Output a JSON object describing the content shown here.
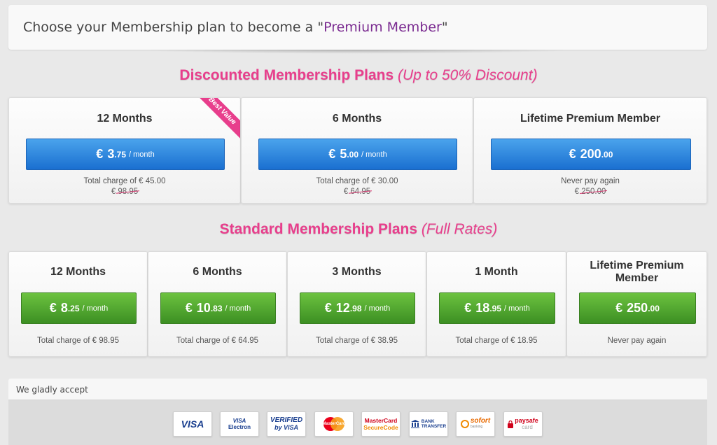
{
  "header": {
    "title_prefix": "Choose your Membership plan to become a ",
    "title_quote_open": "\"",
    "title_accent": "Premium Member",
    "title_quote_close": "\""
  },
  "discounted": {
    "title": "Discounted Membership Plans",
    "subtitle": "(Up to 50% Discount)",
    "plans": [
      {
        "name": "12 Months",
        "currency": "€",
        "amount": "3",
        "cents": ".75",
        "period": "/ month",
        "charge": "Total charge of € 45.00",
        "orig_prefix": "€ ",
        "orig_value": "98.95",
        "ribbon": "Best Value"
      },
      {
        "name": "6 Months",
        "currency": "€",
        "amount": "5",
        "cents": ".00",
        "period": "/ month",
        "charge": "Total charge of € 30.00",
        "orig_prefix": "€ ",
        "orig_value": "64.95"
      },
      {
        "name": "Lifetime Premium Member",
        "currency": "€",
        "amount": "200",
        "cents": ".00",
        "period": "",
        "charge": "Never pay again",
        "orig_prefix": "€ ",
        "orig_value": "250.00"
      }
    ]
  },
  "standard": {
    "title": "Standard Membership Plans",
    "subtitle": "(Full Rates)",
    "plans": [
      {
        "name": "12 Months",
        "currency": "€",
        "amount": "8",
        "cents": ".25",
        "period": "/ month",
        "charge": "Total charge of € 98.95"
      },
      {
        "name": "6 Months",
        "currency": "€",
        "amount": "10",
        "cents": ".83",
        "period": "/ month",
        "charge": "Total charge of € 64.95"
      },
      {
        "name": "3 Months",
        "currency": "€",
        "amount": "12",
        "cents": ".98",
        "period": "/ month",
        "charge": "Total charge of € 38.95"
      },
      {
        "name": "1 Month",
        "currency": "€",
        "amount": "18",
        "cents": ".95",
        "period": "/ month",
        "charge": "Total charge of € 18.95"
      },
      {
        "name": "Lifetime Premium Member",
        "currency": "€",
        "amount": "250",
        "cents": ".00",
        "period": "",
        "charge": "Never pay again"
      }
    ]
  },
  "payments": {
    "label": "We gladly accept",
    "logos": [
      {
        "name": "visa",
        "line1": "VISA",
        "line2": ""
      },
      {
        "name": "visa-electron",
        "line1": "VISA",
        "line2": "Electron"
      },
      {
        "name": "verified-by-visa",
        "line1": "VERIFIED",
        "line2": "by VISA"
      },
      {
        "name": "mastercard",
        "line1": "MasterCard",
        "line2": ""
      },
      {
        "name": "mastercard-securecode",
        "line1": "MasterCard",
        "line2": "SecureCode"
      },
      {
        "name": "bank-transfer",
        "line1": "BANK",
        "line2": "TRANSFER"
      },
      {
        "name": "sofort",
        "line1": "sofort",
        "line2": "banking"
      },
      {
        "name": "paysafecard",
        "line1": "paysafe",
        "line2": "card"
      }
    ]
  },
  "colors": {
    "accent_purple": "#7b2c91",
    "section_pink": "#e83e8c",
    "button_blue": "#1a6fd0",
    "button_green": "#3c8f23"
  }
}
